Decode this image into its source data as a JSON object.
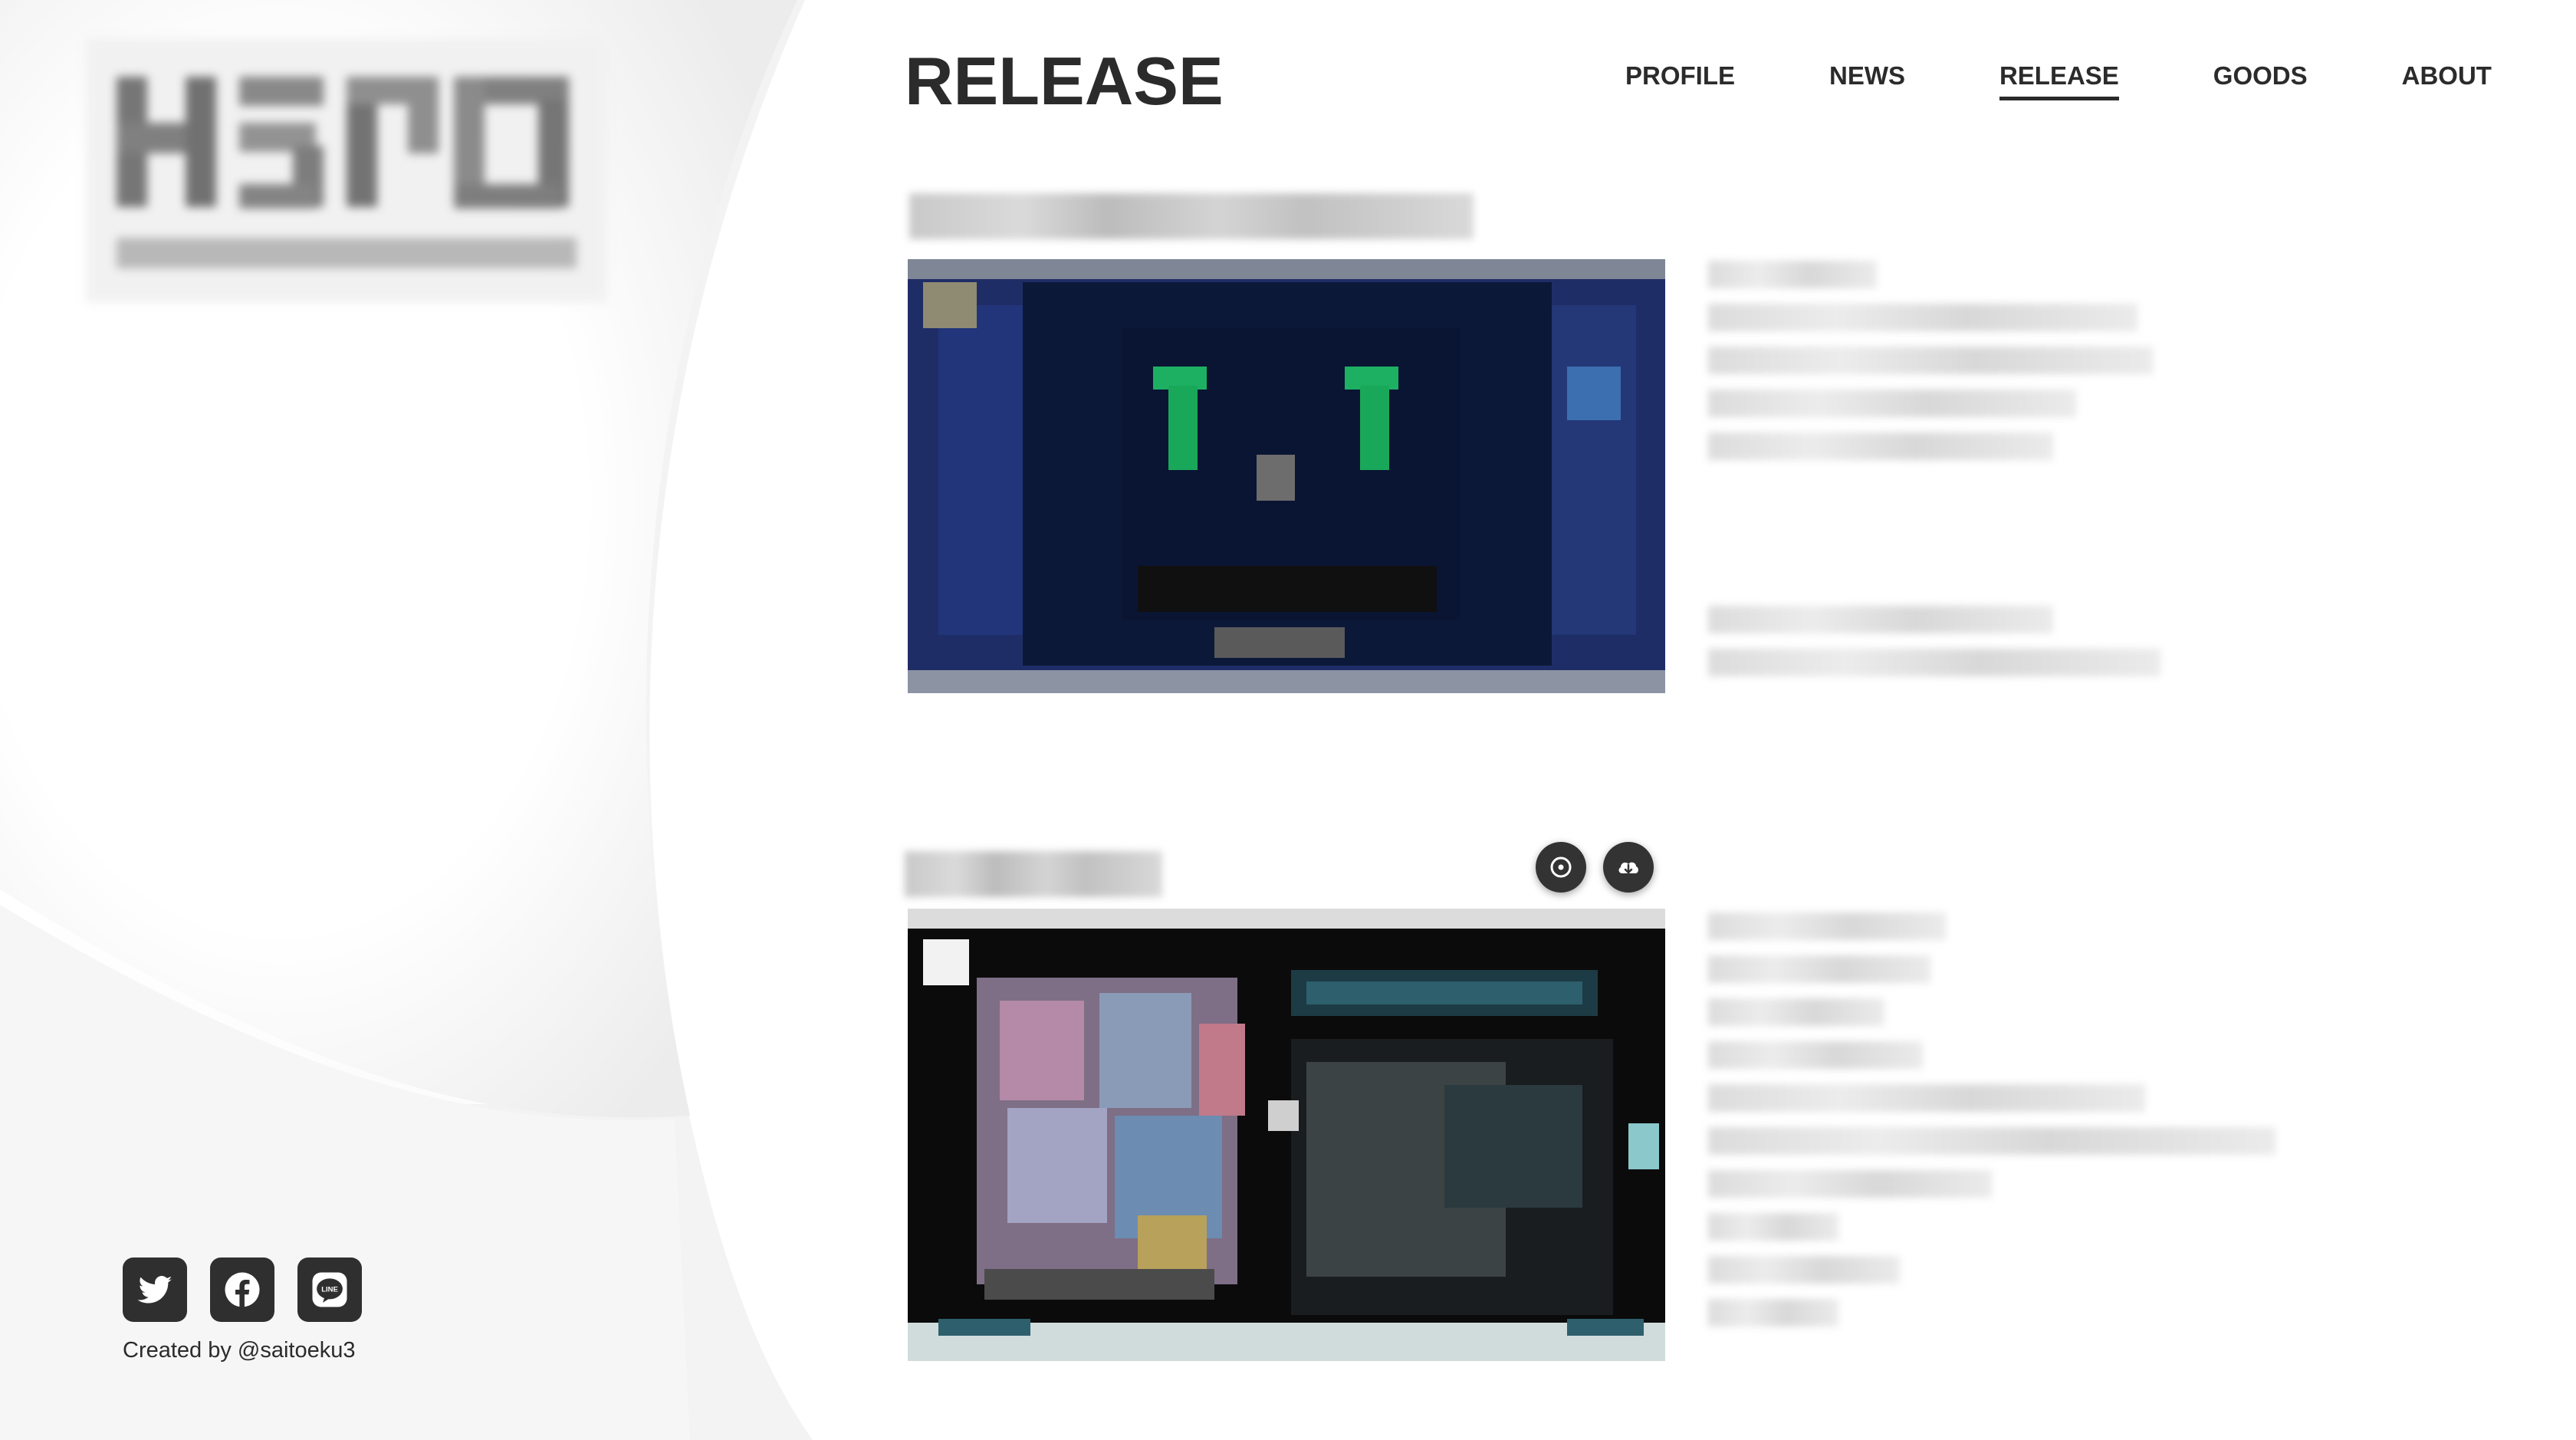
{
  "header": {
    "title": "RELEASE"
  },
  "nav": {
    "items": [
      {
        "label": "PROFILE",
        "active": false
      },
      {
        "label": "NEWS",
        "active": false
      },
      {
        "label": "RELEASE",
        "active": true
      },
      {
        "label": "GOODS",
        "active": false
      },
      {
        "label": "ABOUT",
        "active": false
      }
    ]
  },
  "releases": [
    {
      "heading_visible": "obscured",
      "cover_colors": [
        "#1d2f6b",
        "#0a1230",
        "#1aa85a"
      ],
      "actions": []
    },
    {
      "heading_visible": "obscured",
      "cover_colors": [
        "#0c0c0c",
        "#2e5f6c",
        "#b48aa8"
      ],
      "actions": [
        {
          "icon": "disc-icon",
          "name": "listen-button"
        },
        {
          "icon": "cloud-download-icon",
          "name": "download-button"
        }
      ]
    }
  ],
  "footer": {
    "social": [
      {
        "icon": "twitter-icon",
        "name": "twitter-link"
      },
      {
        "icon": "facebook-icon",
        "name": "facebook-link"
      },
      {
        "icon": "line-icon",
        "name": "line-link"
      }
    ],
    "credit": "Created by @saitoeku3"
  },
  "colors": {
    "text": "#2b2b2b",
    "background": "#ffffff",
    "button": "#333333"
  }
}
